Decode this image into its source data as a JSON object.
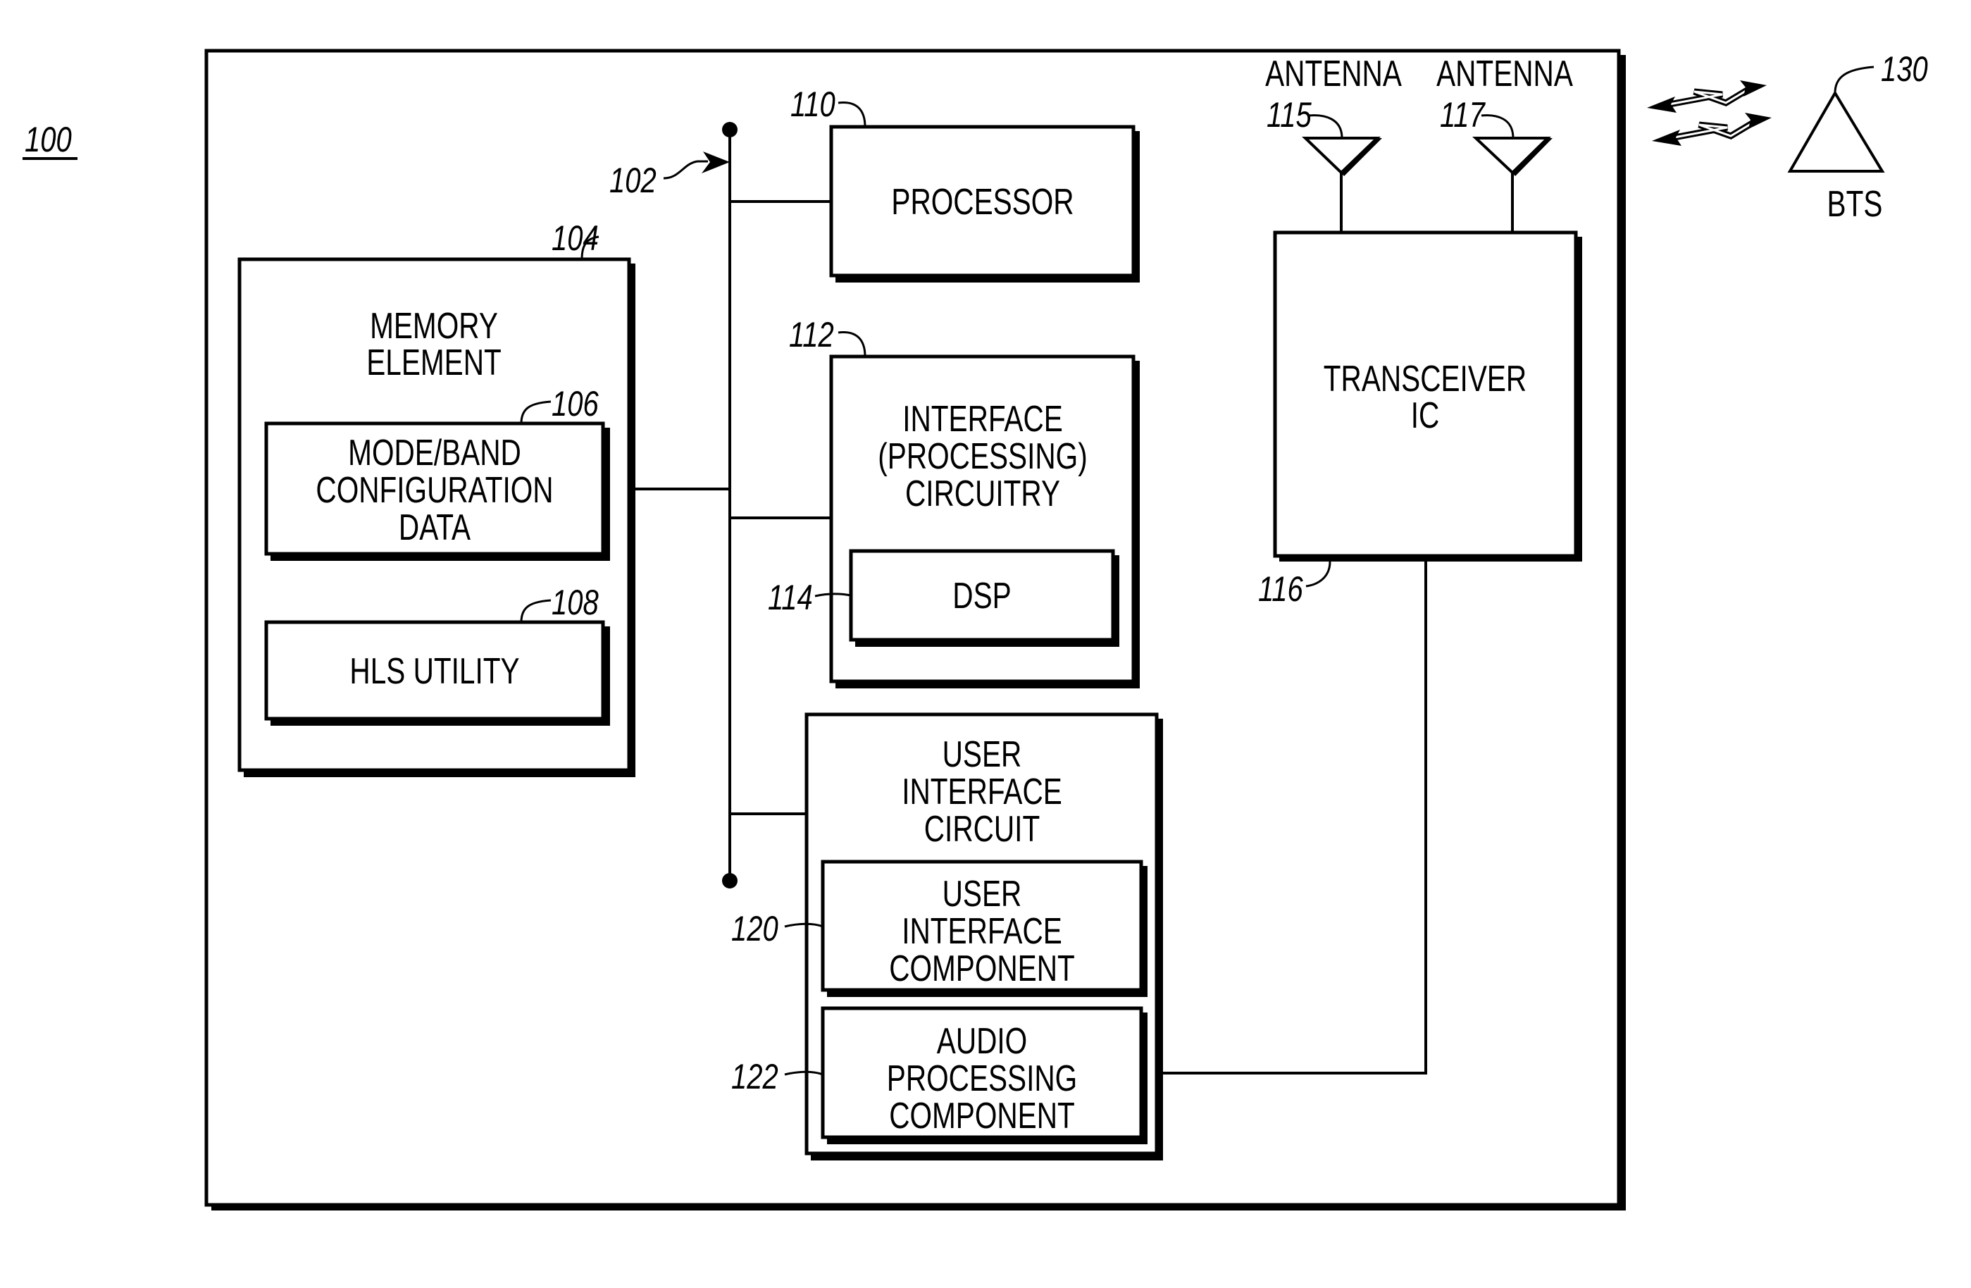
{
  "figure": {
    "reference": "100",
    "colors": {
      "ink": "#000000",
      "paper": "#ffffff"
    }
  },
  "bus": {
    "ref": "102"
  },
  "memory_element": {
    "ref": "104",
    "lines": [
      "MEMORY",
      "ELEMENT"
    ],
    "mode_band_config": {
      "ref": "106",
      "lines": [
        "MODE/BAND",
        "CONFIGURATION",
        "DATA"
      ]
    },
    "hls_utility": {
      "ref": "108",
      "lines": [
        "HLS UTILITY"
      ]
    }
  },
  "processor": {
    "ref": "110",
    "lines": [
      "PROCESSOR"
    ]
  },
  "interface_circuitry": {
    "ref": "112",
    "lines": [
      "INTERFACE",
      "(PROCESSING)",
      "CIRCUITRY"
    ],
    "dsp": {
      "ref": "114",
      "lines": [
        "DSP"
      ]
    }
  },
  "antennas": [
    {
      "label": "ANTENNA",
      "ref": "115"
    },
    {
      "label": "ANTENNA",
      "ref": "117"
    }
  ],
  "transceiver": {
    "ref": "116",
    "lines": [
      "TRANSCEIVER",
      "IC"
    ]
  },
  "user_interface_circuit": {
    "lines": [
      "USER",
      "INTERFACE",
      "CIRCUIT"
    ],
    "ui_component": {
      "ref": "120",
      "lines": [
        "USER",
        "INTERFACE",
        "COMPONENT"
      ]
    },
    "audio_component": {
      "ref": "122",
      "lines": [
        "AUDIO",
        "PROCESSING",
        "COMPONENT"
      ]
    }
  },
  "bts": {
    "ref": "130",
    "label": "BTS"
  }
}
